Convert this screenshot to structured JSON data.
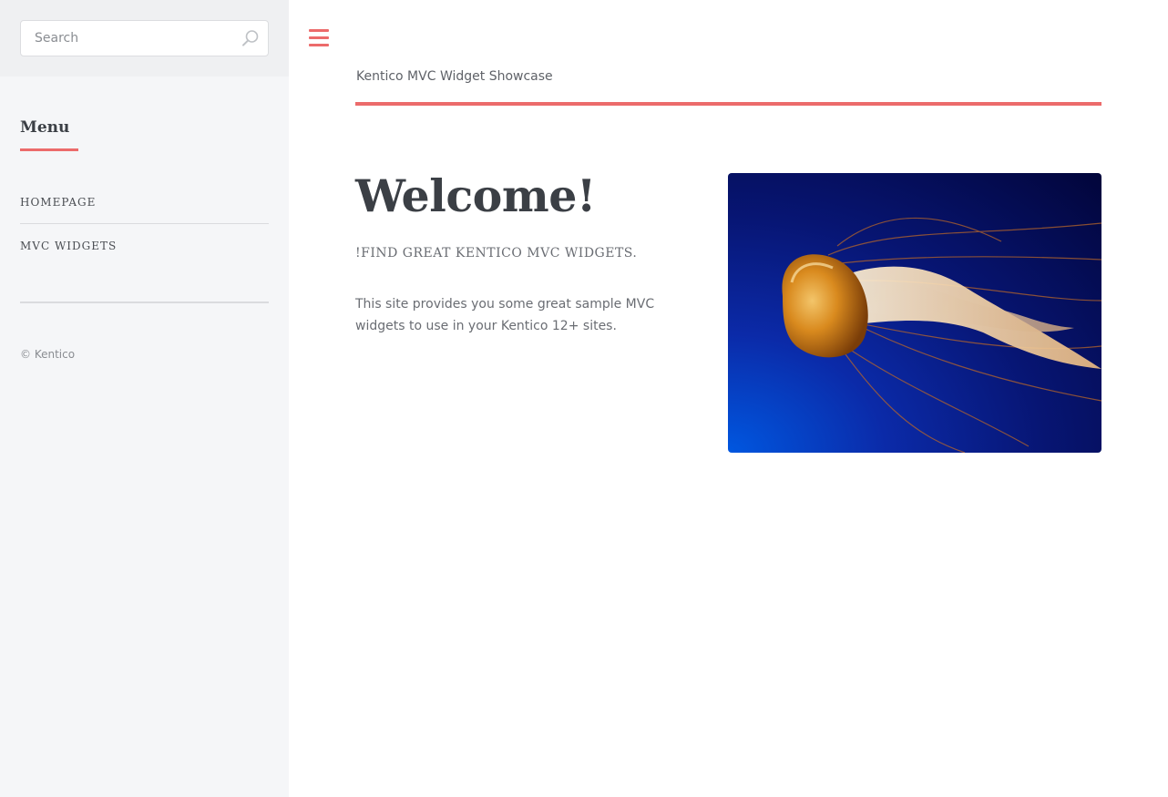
{
  "sidebar": {
    "search": {
      "placeholder": "Search",
      "value": ""
    },
    "menu_title": "Menu",
    "nav_items": [
      {
        "label": "HOMEPAGE"
      },
      {
        "label": "MVC WIDGETS"
      }
    ],
    "copyright": "© Kentico"
  },
  "header": {
    "site_title": "Kentico MVC Widget Showcase"
  },
  "main": {
    "heading": "Welcome!",
    "subtitle": "!FIND GREAT KENTICO MVC WIDGETS.",
    "description": "This site provides you some great sample MVC widgets to use in your Kentico 12+ sites."
  },
  "icons": {
    "search": "search-icon",
    "menu": "hamburger-menu-icon"
  },
  "colors": {
    "accent": "#ec6b6b",
    "heading": "#3b3f45",
    "sidebar_bg": "#f5f6f8"
  }
}
